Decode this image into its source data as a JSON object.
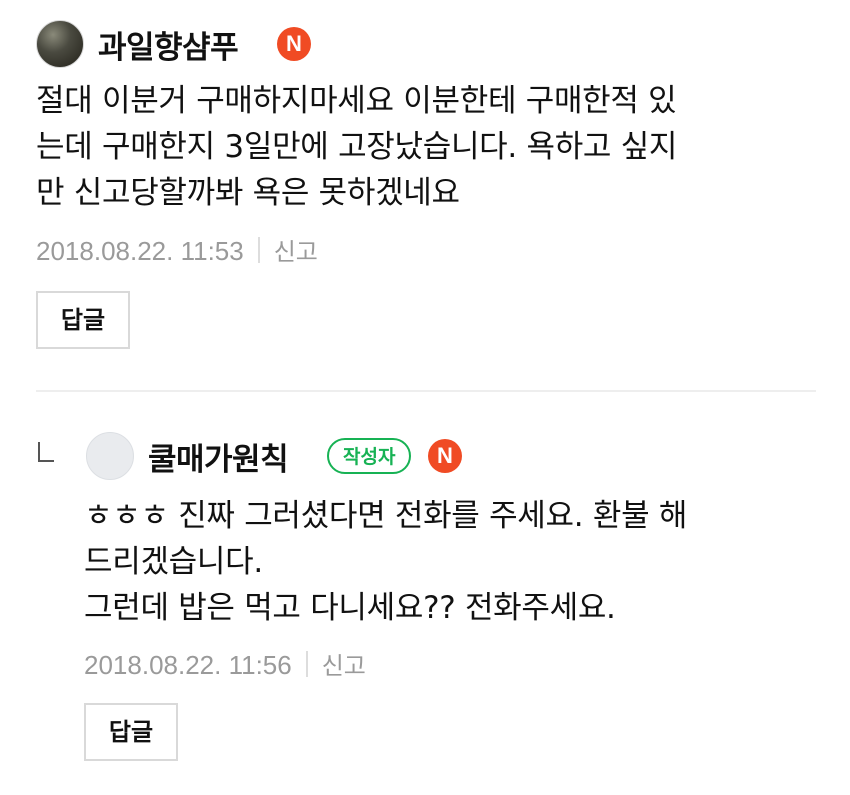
{
  "comments": [
    {
      "username": "과일향샴푸",
      "badge": "N",
      "body_lines": [
        "절대 이분거 구매하지마세요 이분한테 구매한적 있",
        "는데 구매한지 3일만에 고장났습니다. 욕하고 싶지",
        "만 신고당할까봐 욕은 못하겠네요"
      ],
      "timestamp": "2018.08.22. 11:53",
      "report_label": "신고",
      "reply_label": "답글"
    },
    {
      "username": "쿨매가원칙",
      "writer_badge": "작성자",
      "badge": "N",
      "body_lines": [
        "ㅎㅎㅎ 진짜 그러셨다면 전화를 주세요. 환불 해",
        "드리겠습니다.",
        "그런데 밥은 먹고 다니세요?? 전화주세요."
      ],
      "timestamp": "2018.08.22. 11:56",
      "report_label": "신고",
      "reply_label": "답글"
    }
  ],
  "colors": {
    "n_badge": "#f04b24",
    "writer_badge": "#17b254",
    "meta_text": "#9a9a9a"
  },
  "icons": {
    "reply_indicator": "reply-arrow-icon",
    "new_badge": "new-badge-icon"
  }
}
